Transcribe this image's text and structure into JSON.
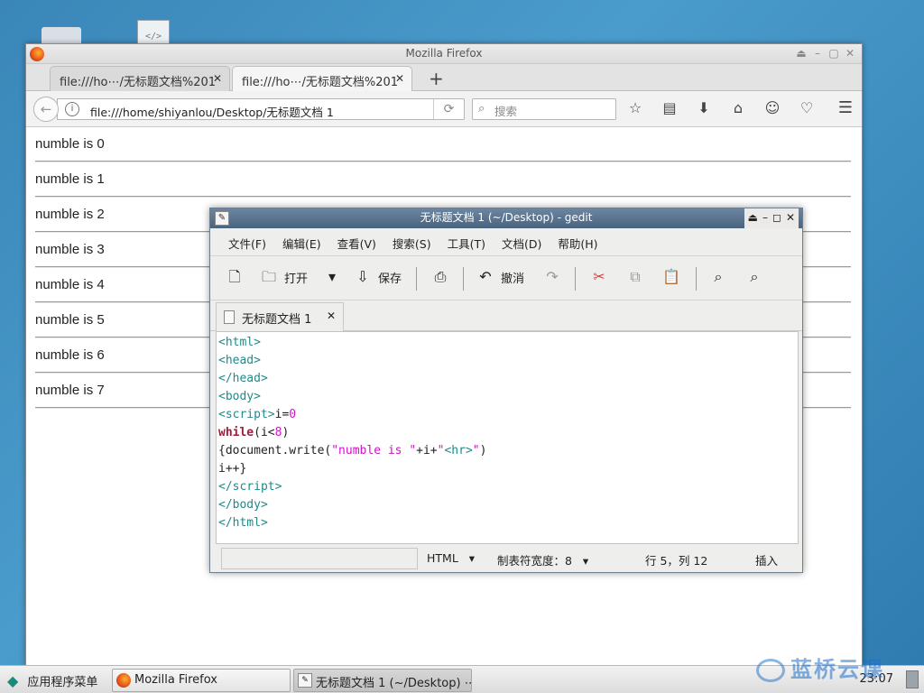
{
  "desktop": {
    "file_icon_glyph": "</>"
  },
  "firefox": {
    "window_title": "Mozilla Firefox",
    "tabs": [
      {
        "label": "file:///ho⋯/无标题文档%201",
        "close": "✕"
      },
      {
        "label": "file:///ho⋯/无标题文档%201",
        "close": "✕"
      }
    ],
    "new_tab": "+",
    "url": "file:///home/shiyanlou/Desktop/无标题文档 1",
    "search_placeholder": "搜索",
    "output_lines": [
      "numble is 0",
      "numble is 1",
      "numble is 2",
      "numble is 3",
      "numble is 4",
      "numble is 5",
      "numble is 6",
      "numble is 7"
    ]
  },
  "gedit": {
    "title": "无标题文档 1 (~/Desktop) - gedit",
    "menu": [
      "文件(F)",
      "编辑(E)",
      "查看(V)",
      "搜索(S)",
      "工具(T)",
      "文档(D)",
      "帮助(H)"
    ],
    "toolbar": {
      "open_label": "打开",
      "save_label": "保存",
      "undo_label": "撤消"
    },
    "doc_tab_label": "无标题文档 1",
    "doc_tab_close": "✕",
    "statusbar": {
      "language": "HTML",
      "tab_width": "制表符宽度：8",
      "position": "行 5，列 12",
      "mode": "插入"
    }
  },
  "taskbar": {
    "app_menu": "应用程序菜单",
    "tasks": [
      {
        "label": "Mozilla Firefox"
      },
      {
        "label": "无标题文档 1 (~/Desktop) ⋯"
      }
    ],
    "clock": "23:07"
  },
  "watermark": "蓝桥云课"
}
